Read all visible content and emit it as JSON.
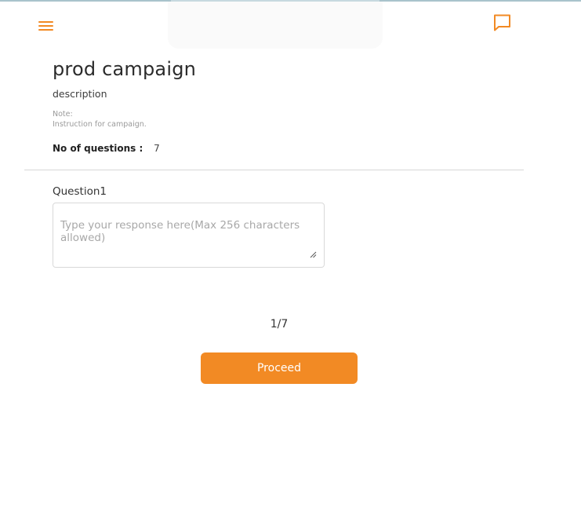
{
  "header": {
    "menu_icon": "hamburger-menu-icon",
    "chat_icon": "chat-bubble-icon",
    "accent_color": "#f28a24"
  },
  "campaign": {
    "title": "prod campaign",
    "description": "description",
    "note_label": "Note:",
    "note_text": "Instruction for campaign.",
    "question_count_label": "No of questions :",
    "question_count_value": "7"
  },
  "question": {
    "label": "Question1",
    "response_value": "",
    "response_placeholder": "Type your response here(Max 256 characters allowed)"
  },
  "pager": {
    "text": "1/7"
  },
  "actions": {
    "proceed_label": "Proceed"
  }
}
